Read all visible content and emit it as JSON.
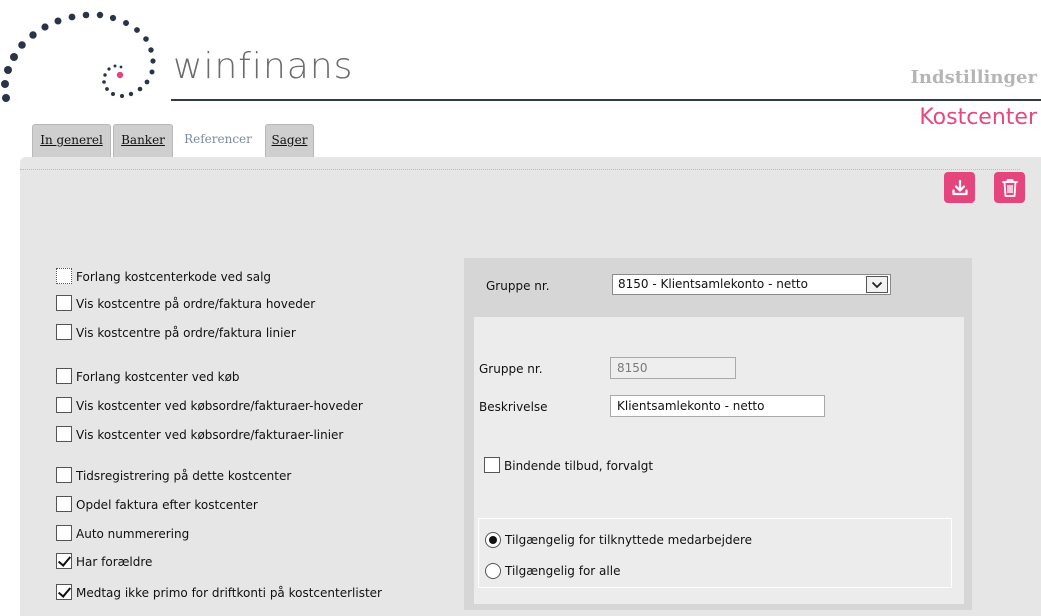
{
  "header": {
    "brand": "winfinans",
    "section": "Indstillinger",
    "title": "Kostcenter"
  },
  "tabs": [
    {
      "label": "In generel",
      "active": false
    },
    {
      "label": "Banker",
      "active": false
    },
    {
      "label": "Referencer",
      "active": true
    },
    {
      "label": "Sager",
      "active": false
    }
  ],
  "toolbar": {
    "download_icon": "download-icon",
    "delete_icon": "trash-icon"
  },
  "checkboxes": [
    {
      "label": "Forlang kostcenterkode ved salg",
      "checked": false
    },
    {
      "label": "Vis kostcentre på ordre/faktura hoveder",
      "checked": false
    },
    {
      "label": "Vis kostcentre på ordre/faktura linier",
      "checked": false
    },
    {
      "label": "Forlang kostcenter ved køb",
      "checked": false
    },
    {
      "label": "Vis kostcenter ved købsordre/fakturaer-hoveder",
      "checked": false
    },
    {
      "label": "Vis kostcenter ved købsordre/fakturaer-linier",
      "checked": false
    },
    {
      "label": "Tidsregistrering på dette kostcenter",
      "checked": false
    },
    {
      "label": "Opdel faktura efter kostcenter",
      "checked": false
    },
    {
      "label": "Auto nummerering",
      "checked": false
    },
    {
      "label": "Har forældre",
      "checked": true
    },
    {
      "label": "Medtag ikke primo for driftkonti på kostcenterlister",
      "checked": true
    }
  ],
  "group_panel": {
    "select_label": "Gruppe nr.",
    "select_value": "8150 - Klientsamlekonto - netto",
    "group_nr_label": "Gruppe nr.",
    "group_nr_value": "8150",
    "description_label": "Beskrivelse",
    "description_value": "Klientsamlekonto - netto",
    "binding_label": "Bindende tilbud, forvalgt",
    "binding_checked": false,
    "radios": [
      {
        "label": "Tilgængelig for tilknyttede medarbejdere",
        "selected": true
      },
      {
        "label": "Tilgængelig for alle",
        "selected": false
      }
    ]
  },
  "colors": {
    "accent": "#e5457d",
    "title": "#e4497f",
    "panel": "#e6e6e6"
  }
}
